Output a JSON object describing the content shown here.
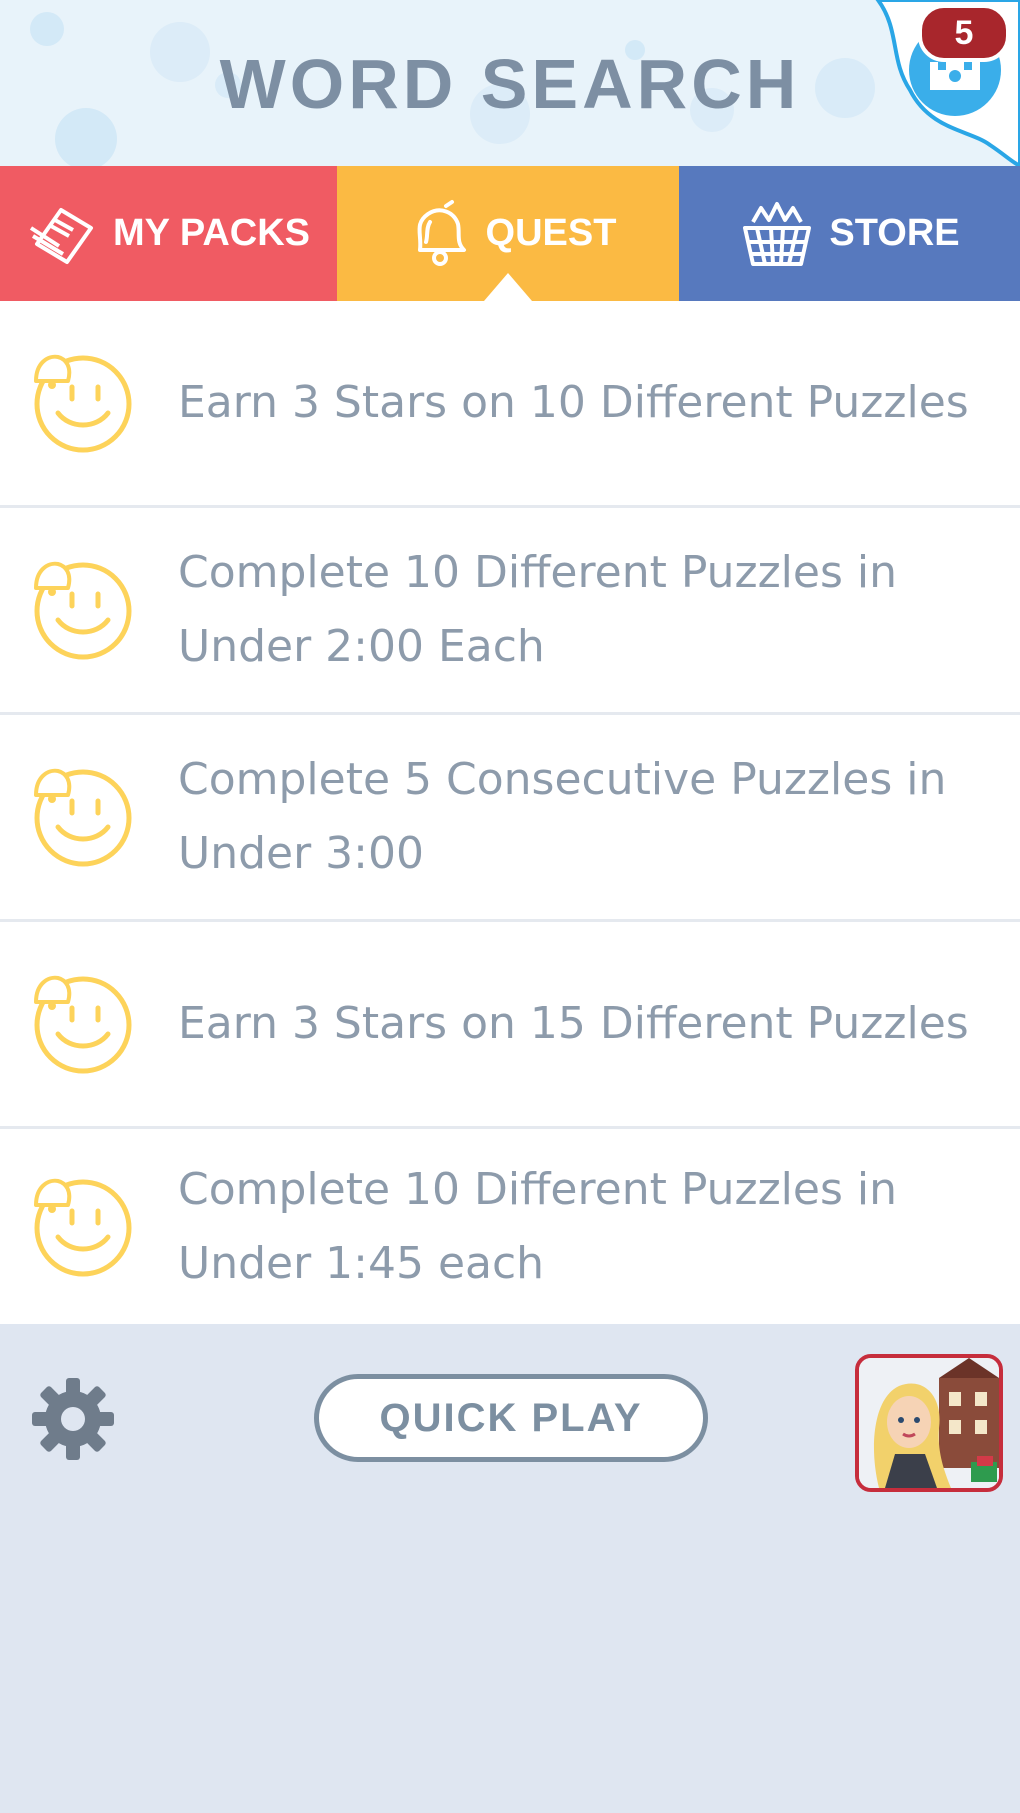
{
  "header": {
    "title": "WORD SEARCH",
    "notification_count": "5",
    "profile_icon": "castle-icon"
  },
  "tabs": [
    {
      "label": "MY PACKS",
      "icon": "cards-icon",
      "color": "#f05b63",
      "active": false
    },
    {
      "label": "QUEST",
      "icon": "bell-icon",
      "color": "#fbba43",
      "active": true
    },
    {
      "label": "STORE",
      "icon": "basket-icon",
      "color": "#5779be",
      "active": false
    }
  ],
  "quests": [
    {
      "text": "Earn 3 Stars on 10 Different Puzzles",
      "icon": "smiley-bell-icon"
    },
    {
      "text": "Complete 10 Different Puzzles in Under 2:00 Each",
      "icon": "smiley-bell-icon"
    },
    {
      "text": "Complete 5 Consecutive Puzzles in Under 3:00",
      "icon": "smiley-bell-icon"
    },
    {
      "text": "Earn 3 Stars on 15 Different Puzzles",
      "icon": "smiley-bell-icon"
    },
    {
      "text": "Complete 10 Different Puzzles in Under 1:45 each",
      "icon": "smiley-bell-icon"
    }
  ],
  "footer": {
    "quick_play_label": "QUICK PLAY",
    "settings_icon": "gear-icon",
    "promo_icon": "game-promo-icon"
  },
  "colors": {
    "accent_quest": "#fbba43",
    "icon_yellow": "#fdd35a",
    "text_gray": "#8d9bab",
    "badge_red": "#a8262c"
  }
}
